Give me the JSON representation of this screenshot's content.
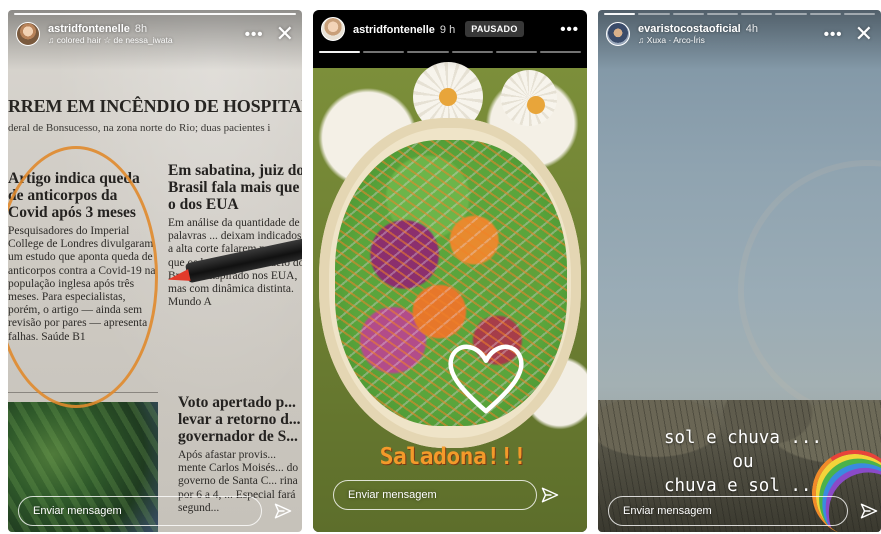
{
  "stories": [
    {
      "username": "astridfontenelle",
      "time": "8h",
      "subline": "colored hair ☆ de nessa_iwata",
      "reply_placeholder": "Enviar mensagem",
      "progress": {
        "total": 1,
        "current": 1
      },
      "newspaper": {
        "headline": "RREM EM INCÊNDIO DE HOSPITAL FEDE",
        "subhead": "deral de Bonsucesso, na zona norte do Rio; duas pacientes i",
        "left_title": "Artigo indica queda de anticorpos da Covid após 3 meses",
        "left_body": "Pesquisadores do Imperial College de Londres divulgaram um estudo que aponta queda de anticorpos contra a Covid-19 na população inglesa após três meses. Para especialistas, porém, o artigo — ainda sem revisão por pares — apresenta falhas. Saúde B1",
        "right_title": "Em sabatina, juiz do Brasil fala mais que o dos EUA",
        "right_body": "Em análise da quantidade de palavras ... deixam indicados a alta corte falarem menos do que os brasileiros. Modelo do Brasil é inspirado nos EUA, mas com dinâmica distinta. Mundo A",
        "bottom_title": "Voto apertado p... levar a retorno d... governador de S...",
        "bottom_body": "Após afastar provis... mente Carlos Moisés... do governo de Santa C... rina por 6 a 4, ... Especial fará segund..."
      }
    },
    {
      "username": "astridfontenelle",
      "time": "9 h",
      "badge": "PAUSADO",
      "reply_placeholder": "Enviar mensagem",
      "progress": {
        "total": 6,
        "current": 1
      },
      "sticker_text": "Saladona!!!"
    },
    {
      "username": "evaristocostaoficial",
      "time": "4h",
      "subline": "Xuxa · Arco-Íris",
      "reply_placeholder": "Enviar mensagem",
      "progress": {
        "total": 8,
        "current": 1
      },
      "text_lines": [
        "sol e chuva ...",
        "ou",
        "chuva e sol ..."
      ]
    }
  ],
  "icons": {
    "more": "•••",
    "close": "✕",
    "music_note": "♫",
    "star": "☆"
  }
}
